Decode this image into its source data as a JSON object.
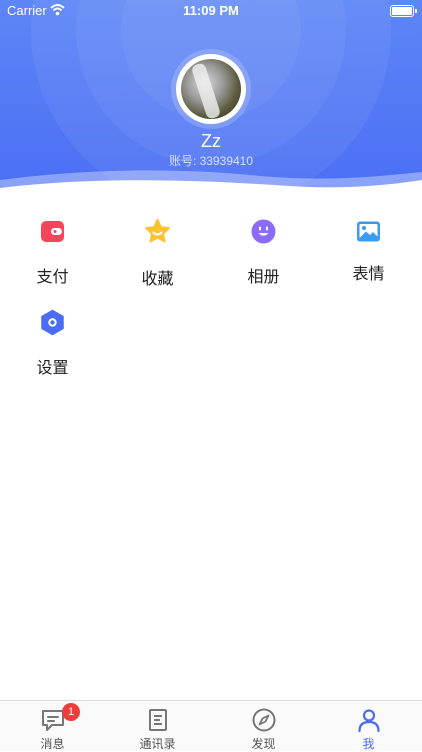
{
  "status_bar": {
    "carrier": "Carrier",
    "time": "11:09 PM"
  },
  "profile": {
    "name": "Zz",
    "account": "账号: 33939410"
  },
  "menu": [
    {
      "label": "支付",
      "icon": "wallet-icon",
      "color": "#f2475a"
    },
    {
      "label": "收藏",
      "icon": "star-icon",
      "color": "#ffc12e"
    },
    {
      "label": "相册",
      "icon": "smiley-icon",
      "color": "#8c6cf4"
    },
    {
      "label": "表情",
      "icon": "picture-icon",
      "color": "#3a9cf0"
    },
    {
      "label": "设置",
      "icon": "settings-hexagon-icon",
      "color": "#4a6df4"
    }
  ],
  "tabbar": {
    "items": [
      {
        "label": "消息",
        "icon": "chat-bubble-icon",
        "badge": "1"
      },
      {
        "label": "通讯录",
        "icon": "contacts-icon"
      },
      {
        "label": "发现",
        "icon": "compass-icon"
      },
      {
        "label": "我",
        "icon": "person-icon",
        "active": true
      }
    ]
  },
  "colors": {
    "accent": "#4a6df4",
    "badge": "#f23b3b"
  }
}
